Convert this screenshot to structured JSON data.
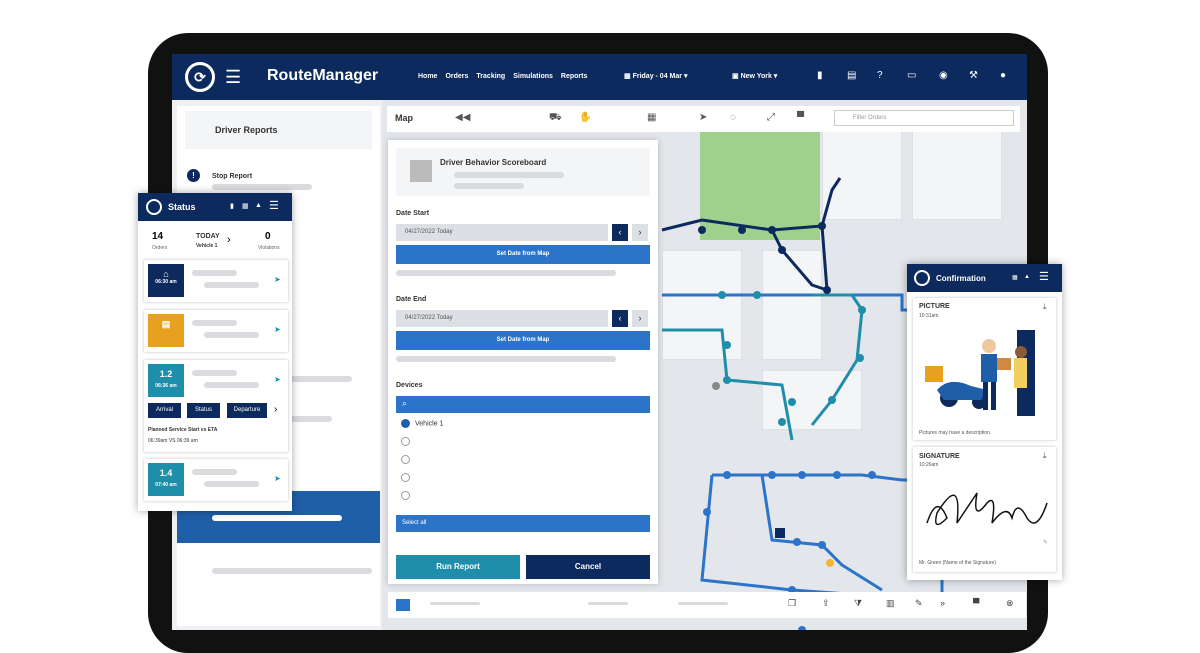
{
  "app": {
    "title": "RouteManager",
    "nav": [
      "Home",
      "Orders",
      "Tracking",
      "Simulations",
      "Reports"
    ],
    "date": "Friday - 04 Mar",
    "city": "New York"
  },
  "map": {
    "label": "Map",
    "filter_placeholder": "Filter Orders"
  },
  "left": {
    "header": "Driver Reports",
    "stop_report": "Stop Report"
  },
  "report": {
    "title": "Driver Behavior Scoreboard",
    "date_start_label": "Date Start",
    "date_start_value": "04/27/2022 Today",
    "date_end_label": "Date End",
    "date_end_value": "04/27/2022 Today",
    "set_date_btn": "Set Date from Map",
    "devices_label": "Devices",
    "vehicle": "Vehicle 1",
    "select_all": "Select all",
    "run": "Run Report",
    "cancel": "Cancel"
  },
  "status": {
    "title": "Status",
    "orders_count": "14",
    "orders_label": "Orders",
    "today": "TODAY",
    "vehicle": "Vehicle 1",
    "violations_count": "0",
    "violations_label": "Violations",
    "stop1_time": "06:30 am",
    "stop2_time": "",
    "stop3_num": "1.2",
    "stop3_time": "06:36 am",
    "arrival": "Arrival",
    "status_btn": "Status",
    "departure": "Departure",
    "planned_label": "Planned Service Start vs ETA",
    "planned_value": "06:39am VS 06:39 am",
    "stop4_num": "1.4",
    "stop4_time": "07:40 am"
  },
  "confirm": {
    "title": "Confirmation",
    "picture_label": "PICTURE",
    "picture_time": "10:31am",
    "picture_caption": "Pictures may have a description.",
    "signature_label": "SIGNATURE",
    "signature_time": "10:26am",
    "signature_name": "Mr. Green (Name of the Signature)"
  },
  "colors": {
    "navy": "#0c2a5e",
    "blue": "#2b74c9",
    "teal": "#1f8eaa",
    "green": "#9fd08c"
  }
}
